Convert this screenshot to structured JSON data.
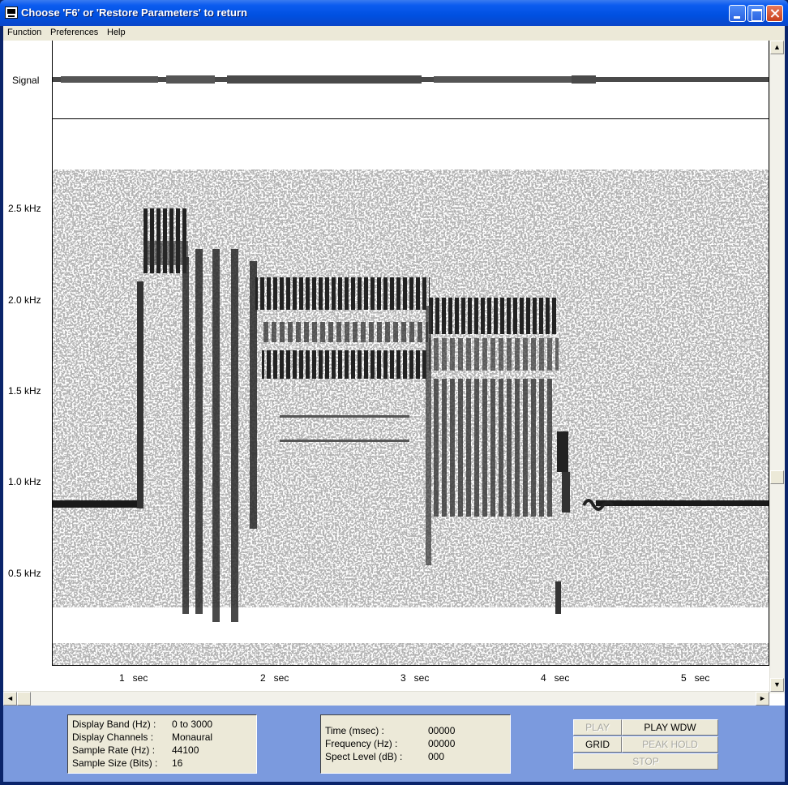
{
  "window": {
    "title": "Choose 'F6' or 'Restore Parameters' to return"
  },
  "menu": {
    "items": [
      "Function",
      "Preferences",
      "Help"
    ]
  },
  "plot": {
    "signal_label": "Signal",
    "freq_labels": [
      "2.5 kHz",
      "2.0 kHz",
      "1.5 kHz",
      "1.0 kHz",
      "0.5 kHz"
    ],
    "time_labels": [
      "1   sec",
      "2   sec",
      "3   sec",
      "4   sec",
      "5   sec"
    ]
  },
  "info": {
    "rows": [
      {
        "label": "Display Band (Hz) :",
        "value": "0 to 3000"
      },
      {
        "label": "Display Channels :",
        "value": "Monaural"
      },
      {
        "label": "Sample Rate (Hz) :",
        "value": "44100"
      },
      {
        "label": "Sample Size (Bits) :",
        "value": "16"
      }
    ]
  },
  "cursor": {
    "rows": [
      {
        "label": "Time (msec) :",
        "value": "00000"
      },
      {
        "label": "Frequency (Hz) :",
        "value": "00000"
      },
      {
        "label": "Spect Level (dB) :",
        "value": "000"
      }
    ]
  },
  "controls": {
    "play": "PLAY",
    "play_wdw": "PLAY WDW",
    "grid": "GRID",
    "peak_hold": "PEAK HOLD",
    "stop": "STOP"
  },
  "colors": {
    "titlebar": "#0050e0",
    "panel_bg": "#7b9ade",
    "control_bg": "#ece9d8"
  }
}
